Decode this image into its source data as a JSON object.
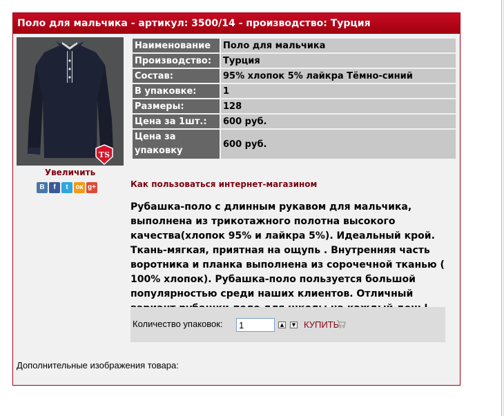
{
  "product": {
    "header_title": "Поло для мальчика - артикул: 3500/14 - производство: Турция",
    "zoom_label": "Увеличить",
    "brand_logo_text": "TS",
    "properties": [
      {
        "key": "Наименование",
        "value": "Поло для мальчика"
      },
      {
        "key": "Производство:",
        "value": "Турция"
      },
      {
        "key": "Состав:",
        "value": "95% хлопок 5% лайкра Тёмно-синий"
      },
      {
        "key": "В упаковке:",
        "value": "1"
      },
      {
        "key": "Размеры:",
        "value": "128"
      },
      {
        "key": "Цена за 1шт.:",
        "value": "600 руб."
      },
      {
        "key": "Цена за упаковку",
        "value": "600 руб."
      }
    ],
    "howto_link": "Как пользоваться интернет-магазином",
    "description": "Рубашка-поло с длинным рукавом для мальчика, выполнена из трикотажного полотна высокого качества(хлопок 95% и лайкра 5%). Идеальный крой. Ткань-мягкая, приятная на ощупь . Внутренняя часть воротника и планка выполнена из сорочечной тканью ( 100% хлопок). Рубашка-поло пользуется большой популярностью среди наших клиентов. Отличный вариант рубашки-поло для школы на каждый день!",
    "extra_images_label": "Дополнительные изображения товара:"
  },
  "social": [
    {
      "name": "vk-icon",
      "glyph": "В",
      "color": "#4a76a8"
    },
    {
      "name": "facebook-icon",
      "glyph": "f",
      "color": "#3b5998"
    },
    {
      "name": "twitter-icon",
      "glyph": "t",
      "color": "#2fa6e0"
    },
    {
      "name": "odnoklassniki-icon",
      "glyph": "ок",
      "color": "#f59a12"
    },
    {
      "name": "google-plus-icon",
      "glyph": "g+",
      "color": "#dd4b39"
    }
  ],
  "buy": {
    "qty_label": "Количество упаковок:",
    "qty_value": "1",
    "buy_label": "КУПИТЬ"
  },
  "colors": {
    "accent": "#a1000f",
    "key_cell": "#666666",
    "value_cell": "#c8c8c8"
  }
}
